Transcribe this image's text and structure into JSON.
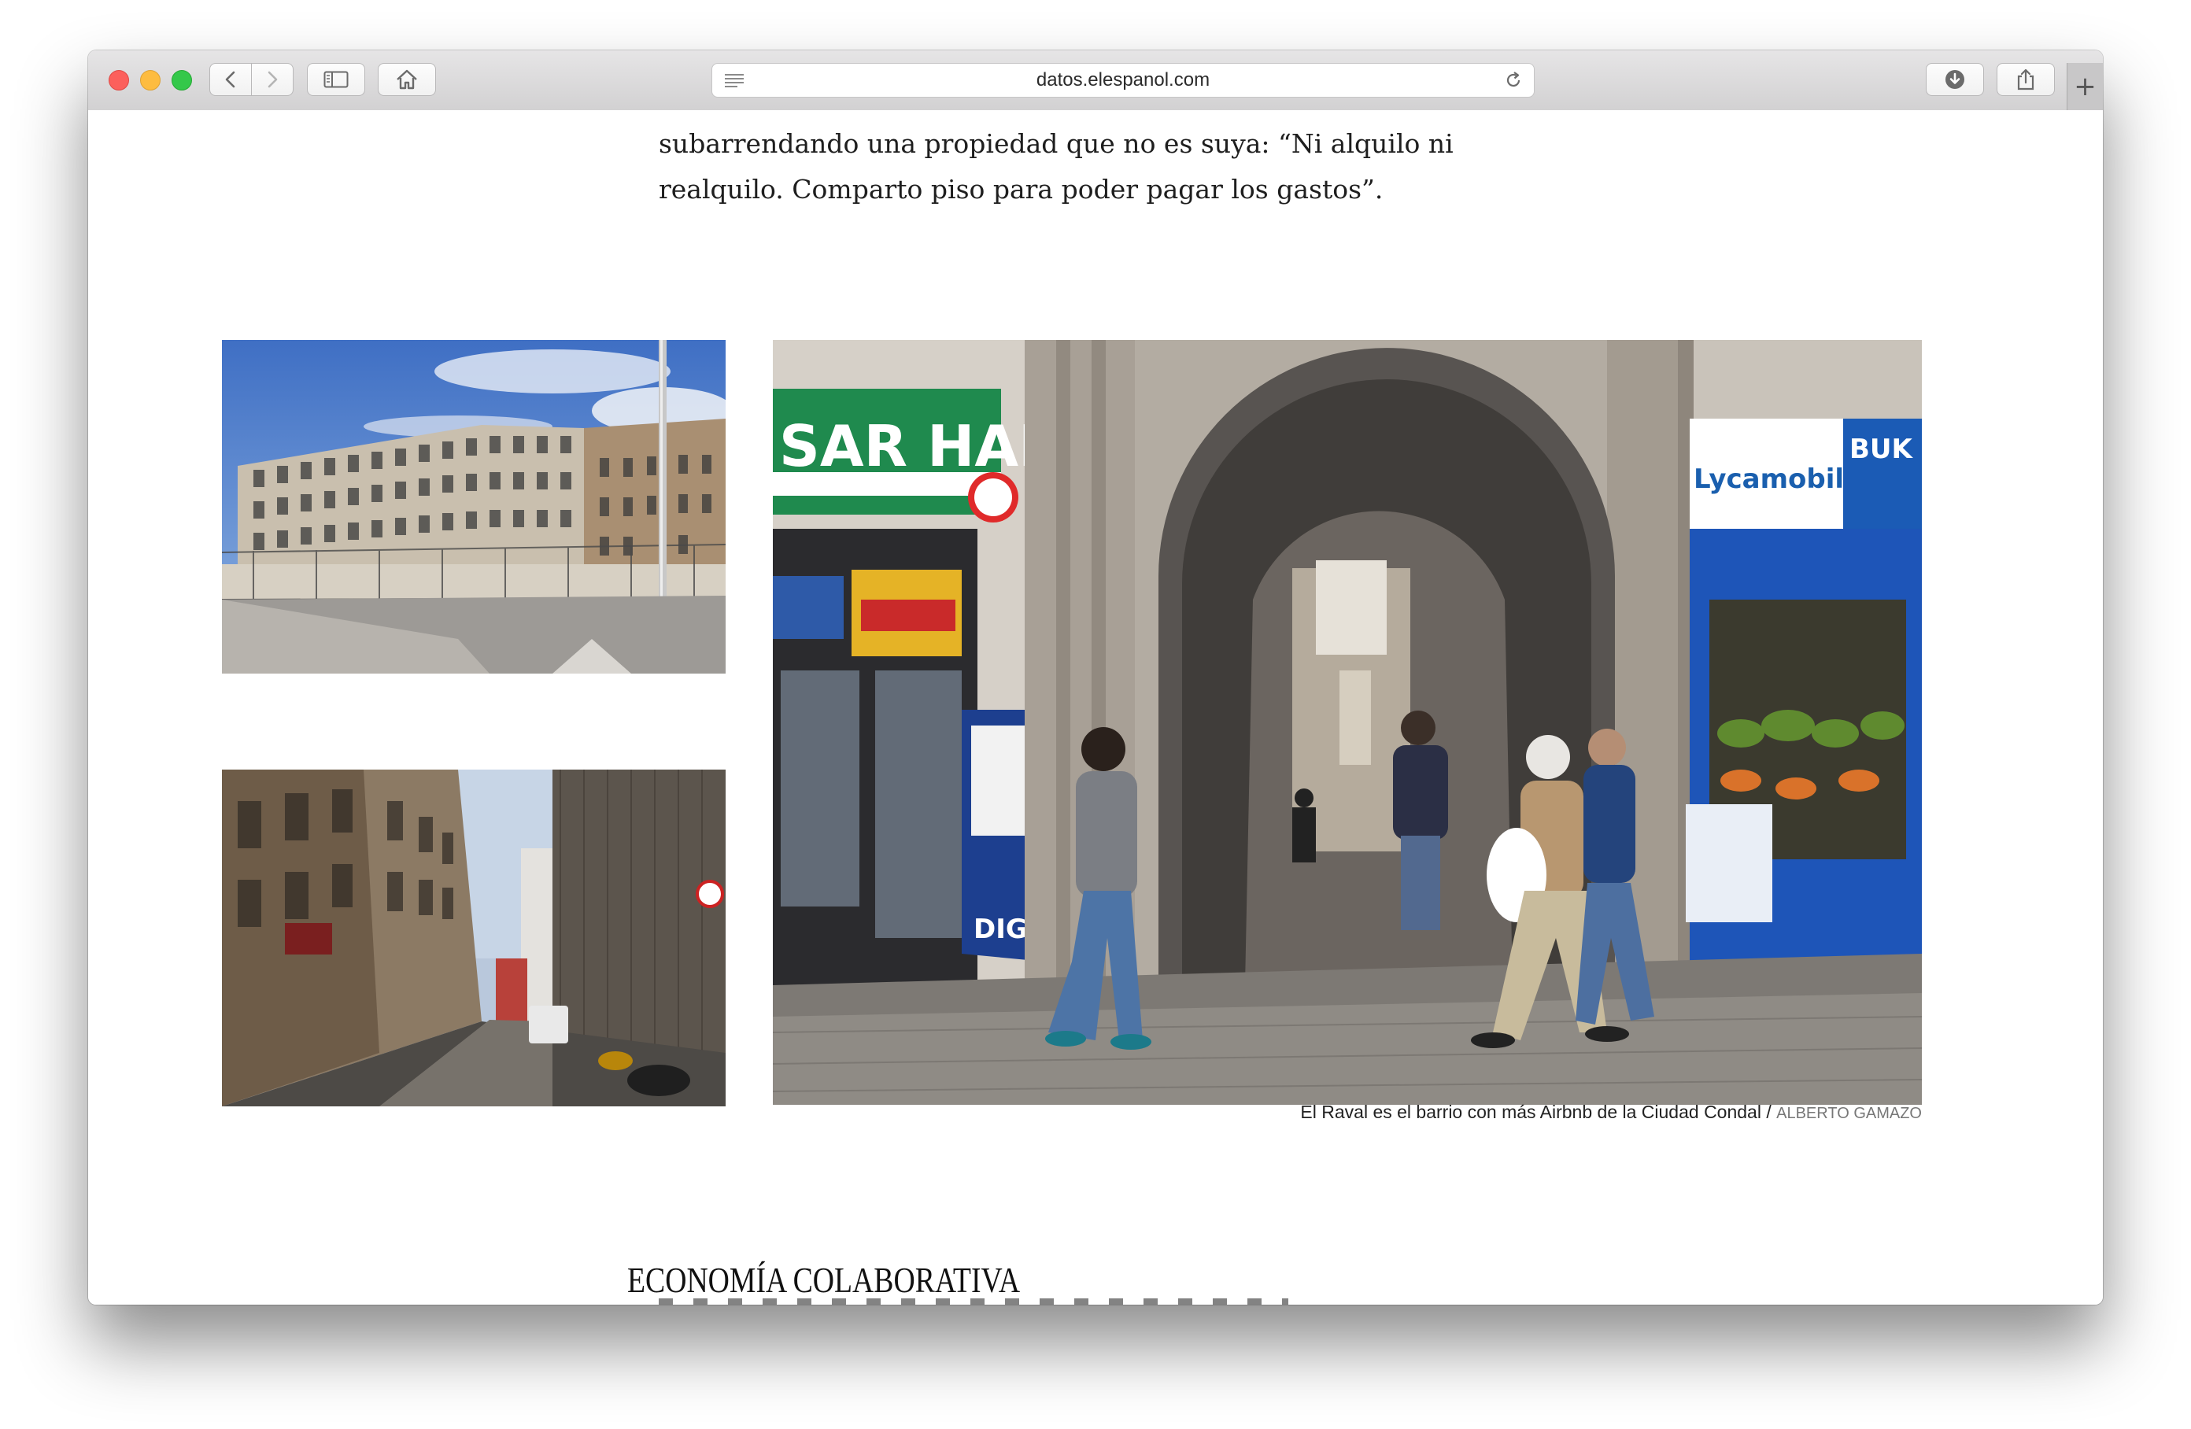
{
  "browser": {
    "url": "datos.elespanol.com",
    "new_tab_label": "+"
  },
  "article": {
    "paragraph_lines": [
      "subarrendando una propiedad que no es suya: “Ni alquilo ni",
      "realquilo. Comparto piso para poder pagar los gastos”."
    ],
    "caption": "El Raval es el barrio con más Airbnb de la Ciudad Condal /",
    "caption_credit": "ALBERTO GAMAZO",
    "section_title": "ECONOMÍA COLABORATIVA",
    "photo_signs": {
      "shop_left": "SAR HARI",
      "shop_right": "Lycamobile",
      "shop_right_2": "BUK",
      "ad_panel": "DIGI"
    }
  },
  "icons": {
    "back": "chevron-left-icon",
    "forward": "chevron-right-icon",
    "sidebar": "sidebar-icon",
    "home": "home-icon",
    "reader": "reader-icon",
    "reload": "reload-icon",
    "download": "download-icon",
    "share": "share-icon"
  },
  "colors": {
    "close": "#fc605c",
    "minimize": "#fdbc40",
    "zoom": "#34c84a",
    "text": "#1e1e1e"
  }
}
